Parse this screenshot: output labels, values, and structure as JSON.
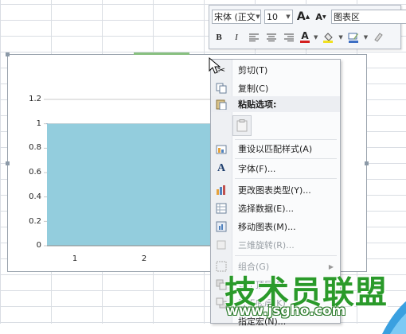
{
  "minibar": {
    "font_name": "宋体 (正文",
    "font_size": "10",
    "grow_label": "A",
    "shrink_label": "A",
    "element_select": "图表区",
    "bold_label": "B",
    "italic_label": "I",
    "font_color_label": "A"
  },
  "context_menu": {
    "items": [
      {
        "label": "剪切(T)",
        "icon": "scissors-icon"
      },
      {
        "label": "复制(C)",
        "icon": "copy-icon"
      },
      {
        "label": "粘贴选项:",
        "icon": "paste-icon"
      },
      {
        "label": "重设以匹配样式(A)",
        "icon": "reset-style-icon"
      },
      {
        "label": "字体(F)...",
        "icon": "font-icon"
      },
      {
        "label": "更改图表类型(Y)...",
        "icon": "chart-type-icon"
      },
      {
        "label": "选择数据(E)...",
        "icon": "select-data-icon"
      },
      {
        "label": "移动图表(M)...",
        "icon": "move-chart-icon"
      },
      {
        "label": "三维旋转(R)...",
        "icon": "rotate-3d-icon"
      },
      {
        "label": "组合(G)",
        "icon": "group-icon"
      },
      {
        "label": "置于顶层(R)",
        "icon": "bring-front-icon"
      },
      {
        "label": "置于底层(K)",
        "icon": "send-back-icon"
      },
      {
        "label": "指定宏(N)...",
        "icon": "macro-icon"
      }
    ]
  },
  "watermark": {
    "main": "技术员联盟",
    "url": "www.jsgho.com"
  },
  "chart_data": {
    "type": "area",
    "categories": [
      "1",
      "2"
    ],
    "series": [
      {
        "values": [
          1,
          1
        ]
      }
    ],
    "y_ticks": [
      "0",
      "0.2",
      "0.4",
      "0.6",
      "0.8",
      "1",
      "1.2"
    ],
    "ylim": [
      0,
      1.2
    ],
    "grid": true,
    "fill_color": "#93cddd",
    "line_color": "#4f81bd"
  }
}
